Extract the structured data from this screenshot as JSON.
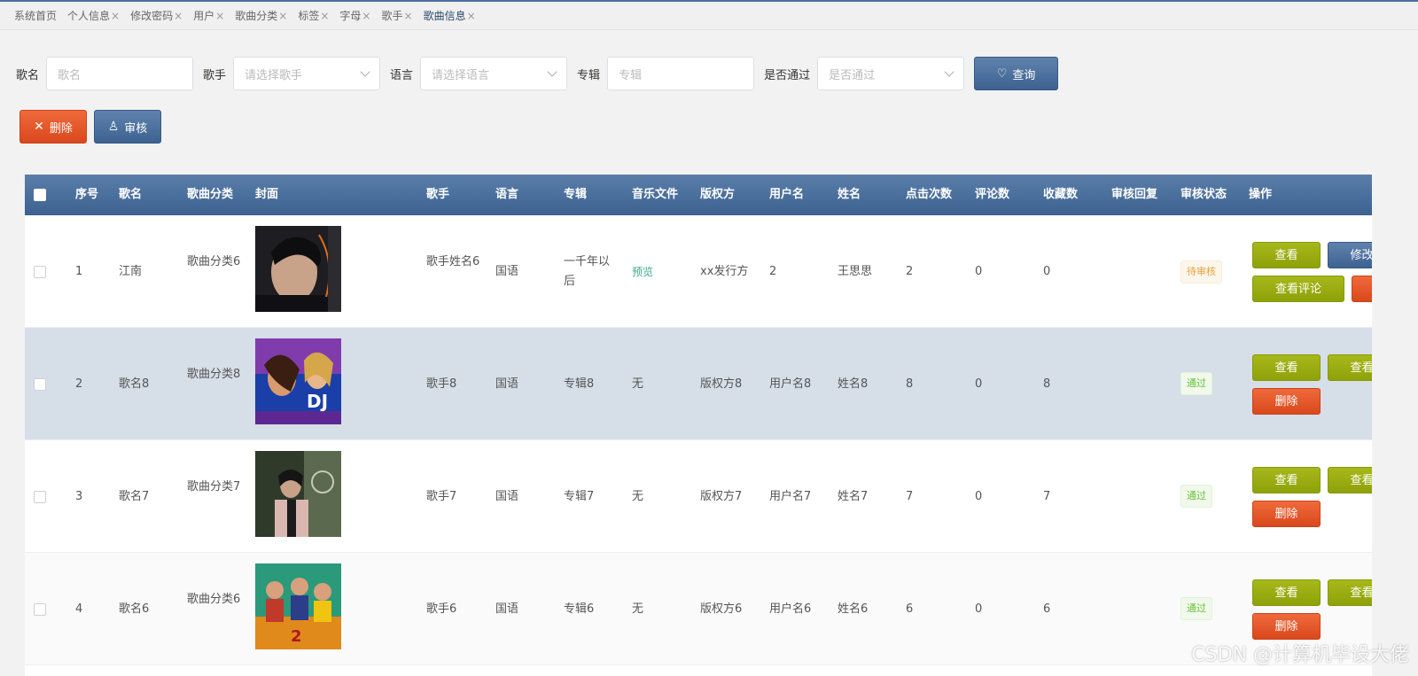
{
  "tabs": [
    {
      "label": "系统首页",
      "closable": false
    },
    {
      "label": "个人信息",
      "closable": true
    },
    {
      "label": "修改密码",
      "closable": true
    },
    {
      "label": "用户",
      "closable": true
    },
    {
      "label": "歌曲分类",
      "closable": true
    },
    {
      "label": "标签",
      "closable": true
    },
    {
      "label": "字母",
      "closable": true
    },
    {
      "label": "歌手",
      "closable": true
    },
    {
      "label": "歌曲信息",
      "closable": true,
      "active": true
    }
  ],
  "search": {
    "song_label": "歌名",
    "song_placeholder": "歌名",
    "singer_label": "歌手",
    "singer_placeholder": "请选择歌手",
    "lang_label": "语言",
    "lang_placeholder": "请选择语言",
    "album_label": "专辑",
    "album_placeholder": "专辑",
    "pass_label": "是否通过",
    "pass_placeholder": "是否通过",
    "query_label": "查询"
  },
  "actions": {
    "delete_label": "删除",
    "audit_label": "审核"
  },
  "columns": [
    "序号",
    "歌名",
    "歌曲分类",
    "封面",
    "歌手",
    "语言",
    "专辑",
    "音乐文件",
    "版权方",
    "用户名",
    "姓名",
    "点击次数",
    "评论数",
    "收藏数",
    "审核回复",
    "审核状态",
    "操作"
  ],
  "rows": [
    {
      "no": "1",
      "song": "江南",
      "category": "歌曲分类6",
      "singer": "歌手姓名6",
      "lang": "国语",
      "album": "一千年以后",
      "file": "预览",
      "copyright": "xx发行方",
      "username": "2",
      "name": "王思思",
      "clicks": "2",
      "comments": "0",
      "favs": "0",
      "reply": "",
      "status": "待审核",
      "ops": {
        "view": "查看",
        "edit": "修改",
        "comments": "查看评论",
        "delete": ""
      }
    },
    {
      "no": "2",
      "song": "歌名8",
      "category": "歌曲分类8",
      "singer": "歌手8",
      "lang": "国语",
      "album": "专辑8",
      "file": "无",
      "copyright": "版权方8",
      "username": "用户名8",
      "name": "姓名8",
      "clicks": "8",
      "comments": "0",
      "favs": "8",
      "reply": "",
      "status": "通过",
      "ops": {
        "view": "查看",
        "second": "查看",
        "delete": "删除"
      }
    },
    {
      "no": "3",
      "song": "歌名7",
      "category": "歌曲分类7",
      "singer": "歌手7",
      "lang": "国语",
      "album": "专辑7",
      "file": "无",
      "copyright": "版权方7",
      "username": "用户名7",
      "name": "姓名7",
      "clicks": "7",
      "comments": "0",
      "favs": "7",
      "reply": "",
      "status": "通过",
      "ops": {
        "view": "查看",
        "second": "查看",
        "delete": "删除"
      }
    },
    {
      "no": "4",
      "song": "歌名6",
      "category": "歌曲分类6",
      "singer": "歌手6",
      "lang": "国语",
      "album": "专辑6",
      "file": "无",
      "copyright": "版权方6",
      "username": "用户名6",
      "name": "姓名6",
      "clicks": "6",
      "comments": "0",
      "favs": "6",
      "reply": "",
      "status": "通过",
      "ops": {
        "view": "查看",
        "second": "查看",
        "delete": "删除"
      }
    }
  ],
  "colors": {
    "header": "#4a6fa0",
    "green": "#9aad12",
    "red": "#e0532a",
    "blue": "#4a6fa0"
  },
  "watermark": "CSDN @计算机毕设大佬"
}
